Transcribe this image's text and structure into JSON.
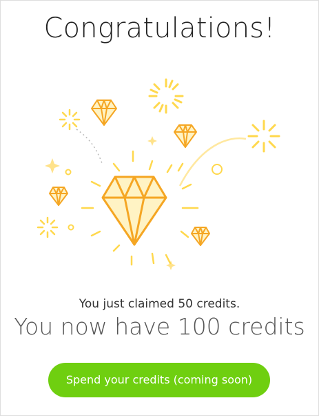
{
  "dialog": {
    "title": "Congratulations!",
    "claimed_message": "You just claimed 50 credits.",
    "total_message": "You now have 100 credits",
    "spend_button_label": "Spend your credits (coming soon)"
  },
  "colors": {
    "accent_green": "#6fcf10",
    "diamond_orange": "#f5a623",
    "sparkle_yellow": "#ffd84d",
    "diamond_fill": "#fff3c4"
  },
  "icons": {
    "main": "diamond-icon",
    "decorations": [
      "small-diamond-icon",
      "sparkle-icon",
      "firework-burst-icon"
    ]
  }
}
